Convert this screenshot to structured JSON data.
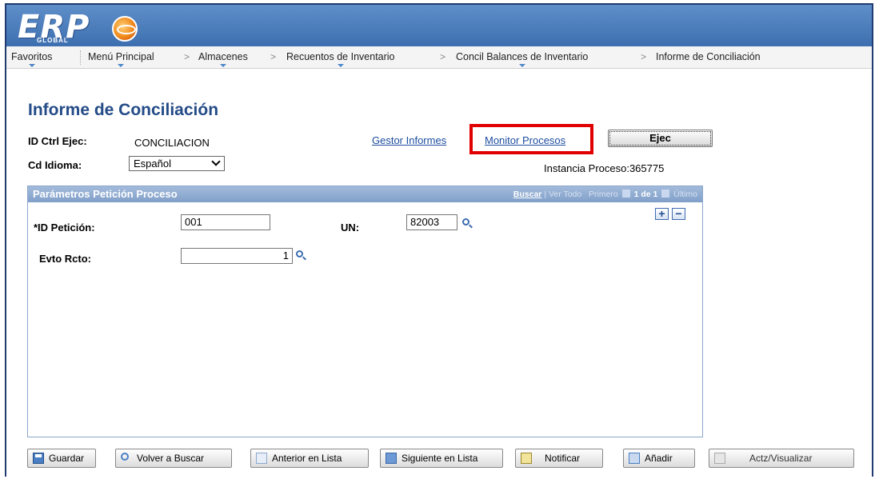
{
  "header": {
    "logo_text": "ERP",
    "logo_sub": "GLOBAL"
  },
  "nav": {
    "favoritos": "Favoritos",
    "menu_principal": "Menú Principal",
    "almacenes": "Almacenes",
    "recuentos": "Recuentos de Inventario",
    "concil": "Concil Balances de Inventario",
    "informe": "Informe de Conciliación",
    "separator": ">"
  },
  "page": {
    "title": "Informe de Conciliación",
    "id_ctrl_label": "ID Ctrl Ejec:",
    "id_ctrl_value": "CONCILIACION",
    "idioma_label": "Cd Idioma:",
    "idioma_value": "Español",
    "gestor_link": "Gestor Informes",
    "monitor_link": "Monitor Procesos",
    "ejec_button": "Ejec",
    "instancia": "Instancia Proceso:365775"
  },
  "panel": {
    "title": "Parámetros Petición Proceso",
    "buscar": "Buscar",
    "ver_todo": "Ver Todo",
    "primero": "Primero",
    "paging": "1 de 1",
    "ultimo": "Último",
    "id_peticion_label": "*ID Petición:",
    "id_peticion_value": "001",
    "un_label": "UN:",
    "un_value": "82003",
    "evto_label": "Evto Rcto:",
    "evto_value": "1",
    "plus": "+",
    "minus": "−"
  },
  "buttons": {
    "guardar": "Guardar",
    "volver": "Volver a Buscar",
    "anterior": "Anterior en Lista",
    "siguiente": "Siguiente en Lista",
    "notificar": "Notificar",
    "anadir": "Añadir",
    "actz": "Actz/Visualizar"
  },
  "colors": {
    "accent": "#234b87",
    "highlight": "#e10000",
    "header": "#4a7fc0"
  }
}
